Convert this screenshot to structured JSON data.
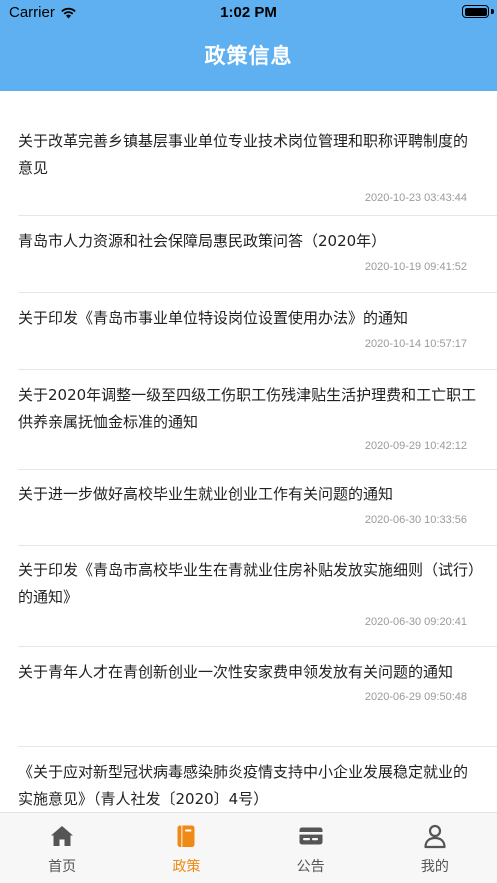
{
  "status_bar": {
    "carrier": "Carrier",
    "time": "1:02 PM"
  },
  "nav": {
    "title": "政策信息"
  },
  "policies": [
    {
      "title": "关于改革完善乡镇基层事业单位专业技术岗位管理和职称评聘制度的意见",
      "time": "2020-10-23 03:43:44"
    },
    {
      "title": "青岛市人力资源和社会保障局惠民政策问答（2020年）",
      "time": "2020-10-19 09:41:52"
    },
    {
      "title": "关于印发《青岛市事业单位特设岗位设置使用办法》的通知",
      "time": "2020-10-14 10:57:17"
    },
    {
      "title": "关于2020年调整一级至四级工伤职工伤残津贴生活护理费和工亡职工供养亲属抚恤金标准的通知",
      "time": "2020-09-29 10:42:12"
    },
    {
      "title": "关于进一步做好高校毕业生就业创业工作有关问题的通知",
      "time": "2020-06-30 10:33:56"
    },
    {
      "title": "关于印发《青岛市高校毕业生在青就业住房补贴发放实施细则（试行）的通知》",
      "time": "2020-06-30 09:20:41"
    },
    {
      "title": "关于青年人才在青创新创业一次性安家费申领发放有关问题的通知",
      "time": "2020-06-29 09:50:48"
    },
    {
      "title": "《关于应对新型冠状病毒感染肺炎疫情支持中小企业发展稳定就业的实施意见》（青人社发〔2020〕4号）",
      "time": ""
    }
  ],
  "tabbar": {
    "tabs": [
      {
        "label": "首页",
        "icon": "home-icon",
        "active": false
      },
      {
        "label": "政策",
        "icon": "book-icon",
        "active": true
      },
      {
        "label": "公告",
        "icon": "card-icon",
        "active": false
      },
      {
        "label": "我的",
        "icon": "person-icon",
        "active": false
      }
    ],
    "active_color": "#f08a16",
    "inactive_color": "#555555"
  },
  "colors": {
    "header": "#5fb0f0"
  }
}
